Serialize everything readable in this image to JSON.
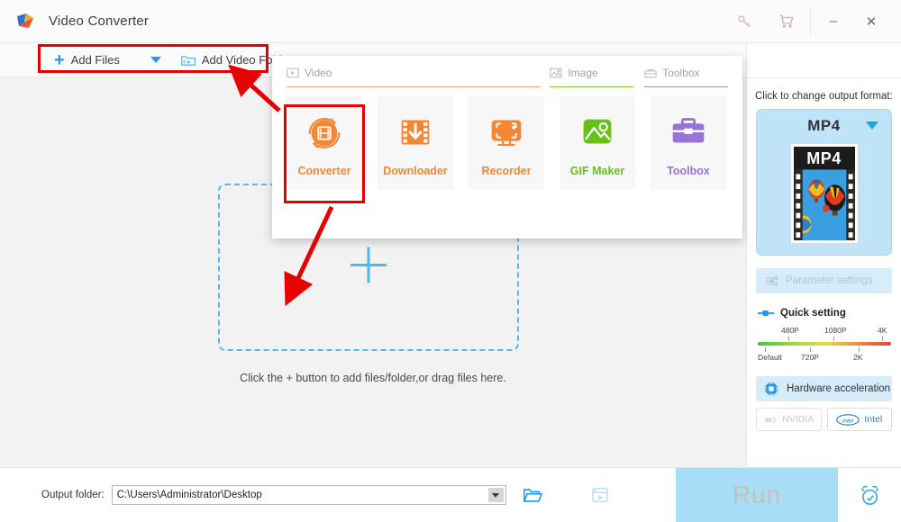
{
  "window": {
    "title": "Video Converter",
    "logo_icon": "app-logo-icon",
    "key_icon": "key-icon",
    "cart_icon": "cart-icon",
    "minimize_label": "–",
    "close_label": "✕"
  },
  "toolbar": {
    "add_files_label": "Add Files",
    "add_files_icon": "plus-icon",
    "dropdown_icon": "chevron-down-icon",
    "add_video_folder_label": "Add Video Folder",
    "add_video_folder_icon": "video-folder-icon"
  },
  "tools_menu": {
    "tabs": [
      {
        "label": "Video",
        "icon": "video-tab-icon",
        "color": "#f0a860"
      },
      {
        "label": "Image",
        "icon": "image-tab-icon",
        "color": "#7ed321"
      },
      {
        "label": "Toolbox",
        "icon": "toolbox-tab-icon",
        "color": "#9b8fd6"
      }
    ],
    "items": [
      {
        "label": "Converter",
        "icon": "converter-icon",
        "color": "#f58634",
        "selected": true
      },
      {
        "label": "Downloader",
        "icon": "downloader-icon",
        "color": "#f58634",
        "selected": false
      },
      {
        "label": "Recorder",
        "icon": "recorder-icon",
        "color": "#f58634",
        "selected": false
      },
      {
        "label": "GIF Maker",
        "icon": "gif-maker-icon",
        "color": "#67c118",
        "selected": false
      },
      {
        "label": "Toolbox",
        "icon": "toolbox-icon",
        "color": "#9b72d9",
        "selected": false
      }
    ]
  },
  "main": {
    "dropzone_plus_icon": "plus-large-icon",
    "hint_text": "Click the + button to add files/folder,or drag files here."
  },
  "right_panel": {
    "output_format_label": "Click to change output format:",
    "format_name": "MP4",
    "format_caret_icon": "chevron-down-icon",
    "thumbnail_label": "MP4",
    "parameter_settings_label": "Parameter settings",
    "parameter_settings_icon": "sliders-icon",
    "quick_setting_label": "Quick setting",
    "quick_setting_icon": "slider-handle-icon",
    "quality_top_labels": [
      "480P",
      "1080P",
      "4K"
    ],
    "quality_bottom_labels": [
      "Default",
      "720P",
      "2K"
    ],
    "hardware_acceleration_label": "Hardware acceleration",
    "hardware_acceleration_icon": "cpu-chip-icon",
    "gpu_options": [
      {
        "label": "NVIDIA",
        "icon": "nvidia-icon",
        "enabled": false
      },
      {
        "label": "Intel",
        "icon": "intel-icon",
        "enabled": true
      }
    ]
  },
  "bottom_bar": {
    "output_folder_label": "Output folder:",
    "output_folder_value": "C:\\Users\\Administrator\\Desktop",
    "output_folder_caret_icon": "chevron-down-icon",
    "browse_icon": "open-folder-icon",
    "media_icon": "media-file-icon",
    "run_label": "Run",
    "alarm_icon": "alarm-clock-icon"
  },
  "annotations": {
    "highlight_color": "#e60000",
    "box_add_files": "add-files-highlight",
    "box_converter": "converter-highlight"
  },
  "colors": {
    "accent_blue": "#2196f3",
    "orange": "#f58634",
    "green": "#67c118",
    "purple": "#9b72d9",
    "panel_bg": "#f2f2f2",
    "highlight_red": "#e60000",
    "run_disabled": "#a8ddf7"
  }
}
